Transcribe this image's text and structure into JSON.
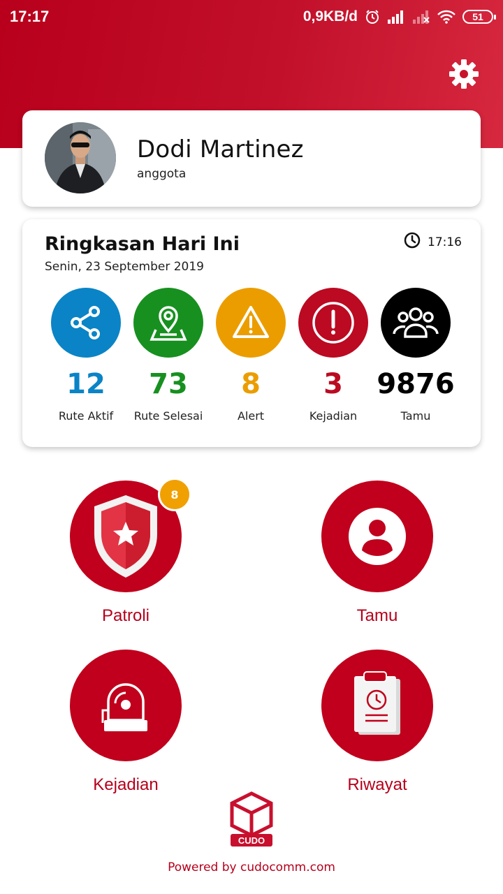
{
  "status_bar": {
    "time": "17:17",
    "network_speed": "0,9KB/d",
    "battery": "51",
    "icons": [
      "alarm-icon",
      "signal-icon",
      "signal-off-icon",
      "wifi-icon",
      "battery-icon"
    ]
  },
  "header": {
    "settings_icon": "gear-icon",
    "accent_color": "#c0001c"
  },
  "profile": {
    "name": "Dodi Martinez",
    "role": "anggota"
  },
  "summary": {
    "title": "Ringkasan Hari Ini",
    "date": "Senin, 23 September 2019",
    "time": "17:16",
    "stats": [
      {
        "icon": "share-icon",
        "value": "12",
        "label": "Rute Aktif",
        "color": "#0a84c6"
      },
      {
        "icon": "map-pin-icon",
        "value": "73",
        "label": "Rute Selesai",
        "color": "#17901f"
      },
      {
        "icon": "warning-icon",
        "value": "8",
        "label": "Alert",
        "color": "#eb9d00"
      },
      {
        "icon": "exclamation-icon",
        "value": "3",
        "label": "Kejadian",
        "color": "#bb0a22"
      },
      {
        "icon": "group-icon",
        "value": "9876",
        "label": "Tamu",
        "color": "#000000"
      }
    ]
  },
  "menu": [
    {
      "icon": "shield-star-icon",
      "label": "Patroli",
      "badge": "8"
    },
    {
      "icon": "user-circle-icon",
      "label": "Tamu"
    },
    {
      "icon": "alarm-bell-icon",
      "label": "Kejadian"
    },
    {
      "icon": "clipboard-history-icon",
      "label": "Riwayat"
    }
  ],
  "footer": {
    "logo_text": "CUDO",
    "powered_by": "Powered by cudocomm.com"
  }
}
